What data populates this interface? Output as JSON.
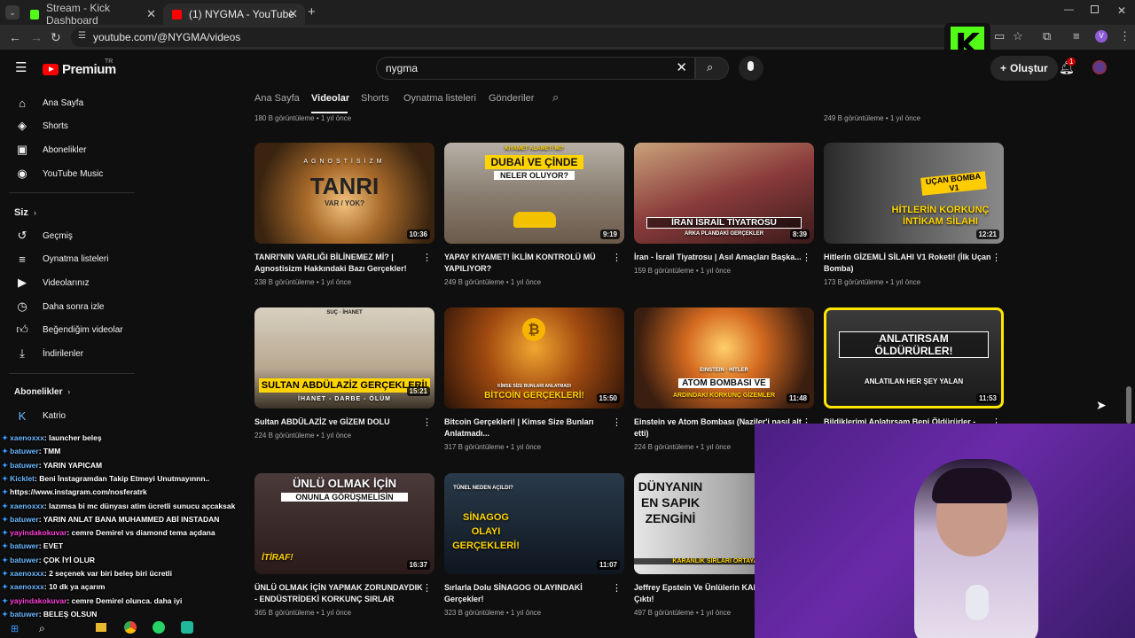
{
  "browser": {
    "tabs": [
      {
        "title": "Stream - Kick Dashboard",
        "favicon_color": "#53fc18"
      },
      {
        "title": "(1) NYGMA - YouTube",
        "favicon_color": "#ff0000"
      }
    ],
    "new_tab": "+",
    "url": "youtube.com/@NYGMA/videos"
  },
  "masthead": {
    "logo_text": "Premium",
    "logo_region": "TR",
    "search_value": "nygma",
    "create_label": "Oluştur",
    "notification_count": "1"
  },
  "sidebar": {
    "top": [
      {
        "label": "Ana Sayfa",
        "icon": "home-icon"
      },
      {
        "label": "Shorts",
        "icon": "shorts-icon"
      },
      {
        "label": "Abonelikler",
        "icon": "subscriptions-icon"
      },
      {
        "label": "YouTube Music",
        "icon": "music-icon"
      }
    ],
    "you_heading": "Siz",
    "you": [
      {
        "label": "Geçmiş",
        "icon": "history-icon"
      },
      {
        "label": "Oynatma listeleri",
        "icon": "playlists-icon"
      },
      {
        "label": "Videolarınız",
        "icon": "your-videos-icon"
      },
      {
        "label": "Daha sonra izle",
        "icon": "watch-later-icon"
      },
      {
        "label": "Beğendiğim videolar",
        "icon": "liked-icon"
      },
      {
        "label": "İndirilenler",
        "icon": "downloads-icon"
      }
    ],
    "subs_heading": "Abonelikler",
    "subs": [
      {
        "label": "Katrio"
      }
    ]
  },
  "channel_tabs": [
    "Ana Sayfa",
    "Videolar",
    "Shorts",
    "Oynatma listeleri",
    "Gönderiler"
  ],
  "prev_row_meta": [
    "180 B görüntüleme • 1 yıl önce",
    "249 B görüntüleme • 1 yıl önce"
  ],
  "videos": [
    {
      "title": "TANRI'NIN VARLIĞI BİLİNEMEZ Mİ? | Agnostisizm Hakkındaki Bazı Gerçekler!",
      "meta": "238 B görüntüleme • 1 yıl önce",
      "duration": "10:36",
      "thumb_text": "TANRI",
      "thumb_sub": "VAR / YOK?",
      "thumb_top": "AGNOSTİSİZM",
      "bg": "#6b4a1e"
    },
    {
      "title": "YAPAY KIYAMET! İKLİM KONTROLÜ MÜ YAPILIYOR?",
      "meta": "249 B görüntüleme • 1 yıl önce",
      "duration": "9:19",
      "thumb_text": "DUBAİ VE ÇİNDE",
      "thumb_sub": "NELER OLUYOR?",
      "thumb_top": "KIYAMET ALAMETİ Mİ?",
      "bg": "#8a7f72"
    },
    {
      "title": "İran - İsrail Tiyatrosu | Asıl Amaçları Başka...",
      "meta": "159 B görüntüleme • 1 yıl önce",
      "duration": "8:39",
      "thumb_text": "İRAN İSRAİL TİYATROSU",
      "thumb_sub": "ARKA PLANDAKİ GERÇEKLER",
      "thumb_top": "",
      "bg": "#8a3b3b"
    },
    {
      "title": "Hitlerin GİZEMLİ SİLAHI V1 Roketi! (İlk Uçan Bomba)",
      "meta": "173 B görüntüleme • 1 yıl önce",
      "duration": "12:21",
      "thumb_text": "HİTLERİN KORKUNÇ İNTİKAM SİLAHI",
      "thumb_sub": "UÇAN BOMBA V1",
      "thumb_top": "",
      "bg": "#4a4a4a"
    },
    {
      "title": "Sultan ABDÜLAZİZ ve GİZEM DOLU ÖLÜMÜ!",
      "meta": "224 B görüntüleme • 1 yıl önce",
      "duration": "15:21",
      "thumb_text": "SULTAN ABDÜLAZİZ GERÇEKLERİ!",
      "thumb_sub": "İHANET - DARBE - ÖLÜM",
      "thumb_top": "SUÇ · İHANET",
      "bg": "#3b3226"
    },
    {
      "title": "Bitcoin Gerçekleri! | Kimse Size Bunları Anlatmadı...",
      "meta": "317 B görüntüleme • 1 yıl önce",
      "duration": "15:50",
      "thumb_text": "BİTCOİN GERÇEKLERİ!",
      "thumb_sub": "KİMSE SİZE BUNLARI ANLATMADI",
      "thumb_top": "",
      "bg": "#7a3a10"
    },
    {
      "title": "Einstein ve Atom Bombası (Naziler'i nasıl alt etti)",
      "meta": "224 B görüntüleme • 1 yıl önce",
      "duration": "11:48",
      "thumb_text": "ATOM BOMBASI VE",
      "thumb_sub": "ARDINDAKİ KORKUNÇ GİZEMLER",
      "thumb_top": "EINSTEIN · HİTLER",
      "bg": "#6a3a20"
    },
    {
      "title": "Bildiklerimi Anlatırsam Beni Öldürürler -",
      "meta": "",
      "duration": "11:53",
      "thumb_text": "ANLATIRSAM ÖLDÜRÜRLER!",
      "thumb_sub": "ANLATILAN HER ŞEY YALAN",
      "thumb_top": "",
      "bg": "#2e2e2e"
    },
    {
      "title": "ÜNLÜ OLMAK İÇİN YAPMAK ZORUNDAYDIK - ENDÜSTRİDEKİ KORKUNÇ SIRLAR",
      "meta": "365 B görüntüleme • 1 yıl önce",
      "duration": "16:37",
      "thumb_text": "ÜNLÜ OLMAK İÇİN",
      "thumb_sub": "İTİRAF!",
      "thumb_top": "ONUNLA GÖRÜŞMELİSİN",
      "bg": "#3a2a2a"
    },
    {
      "title": "Sırlarla Dolu SİNAGOG OLAYINDAKİ Gerçekler!",
      "meta": "323 B görüntüleme • 1 yıl önce",
      "duration": "11:07",
      "thumb_text": "SİNAGOG OLAYI GERÇEKLERİ!",
      "thumb_sub": "",
      "thumb_top": "TÜNEL NEDEN AÇILDI?",
      "bg": "#1e2a3a"
    },
    {
      "title": "Jeffrey Epstein Ve Ünlülerin KAR Ortaya Çıktı!",
      "meta": "497 B görüntüleme • 1 yıl önce",
      "duration": "",
      "thumb_text": "DÜNYANIN EN SAPIK ZENGİNİ",
      "thumb_sub": "KARANLIK SIRLARI ORTAYA ÇIKTI",
      "thumb_top": "",
      "bg": "#5a5a5a"
    }
  ],
  "chat": [
    {
      "user": "xaenoxxx",
      "msg": "launcher beleş",
      "alt": false
    },
    {
      "user": "batuwer",
      "msg": "TMM",
      "alt": false
    },
    {
      "user": "batuwer",
      "msg": "YARIN YAPICAM",
      "alt": false
    },
    {
      "user": "Kicklet",
      "msg": "Beni İnstagramdan Takip Etmeyi Unutmayınnn..",
      "alt": false
    },
    {
      "user": "",
      "msg": "https://www.instagram.com/nosferatrk",
      "alt": false
    },
    {
      "user": "xaenoxxx",
      "msg": "lazımsa bi mc dünyası atim ücretli sunucu açcaksak",
      "alt": false
    },
    {
      "user": "batuwer",
      "msg": "YARIN ANLAT BANA MUHAMMED ABİ INSTADAN",
      "alt": false
    },
    {
      "user": "yayindakokuvar",
      "msg": "cemre Demirel vs diamond tema açdana",
      "alt": true
    },
    {
      "user": "batuwer",
      "msg": "EVET",
      "alt": false
    },
    {
      "user": "batuwer",
      "msg": "ÇOK İYİ OLUR",
      "alt": false
    },
    {
      "user": "xaenoxxx",
      "msg": "2 seçenek var biri beleş biri ücretli",
      "alt": false
    },
    {
      "user": "xaenoxxx",
      "msg": "10 dk ya açarım",
      "alt": false
    },
    {
      "user": "yayindakokuvar",
      "msg": "cemre Demirel olunca. daha iyi",
      "alt": true
    },
    {
      "user": "batuwer",
      "msg": "BELEŞ OLSUN",
      "alt": false
    }
  ]
}
